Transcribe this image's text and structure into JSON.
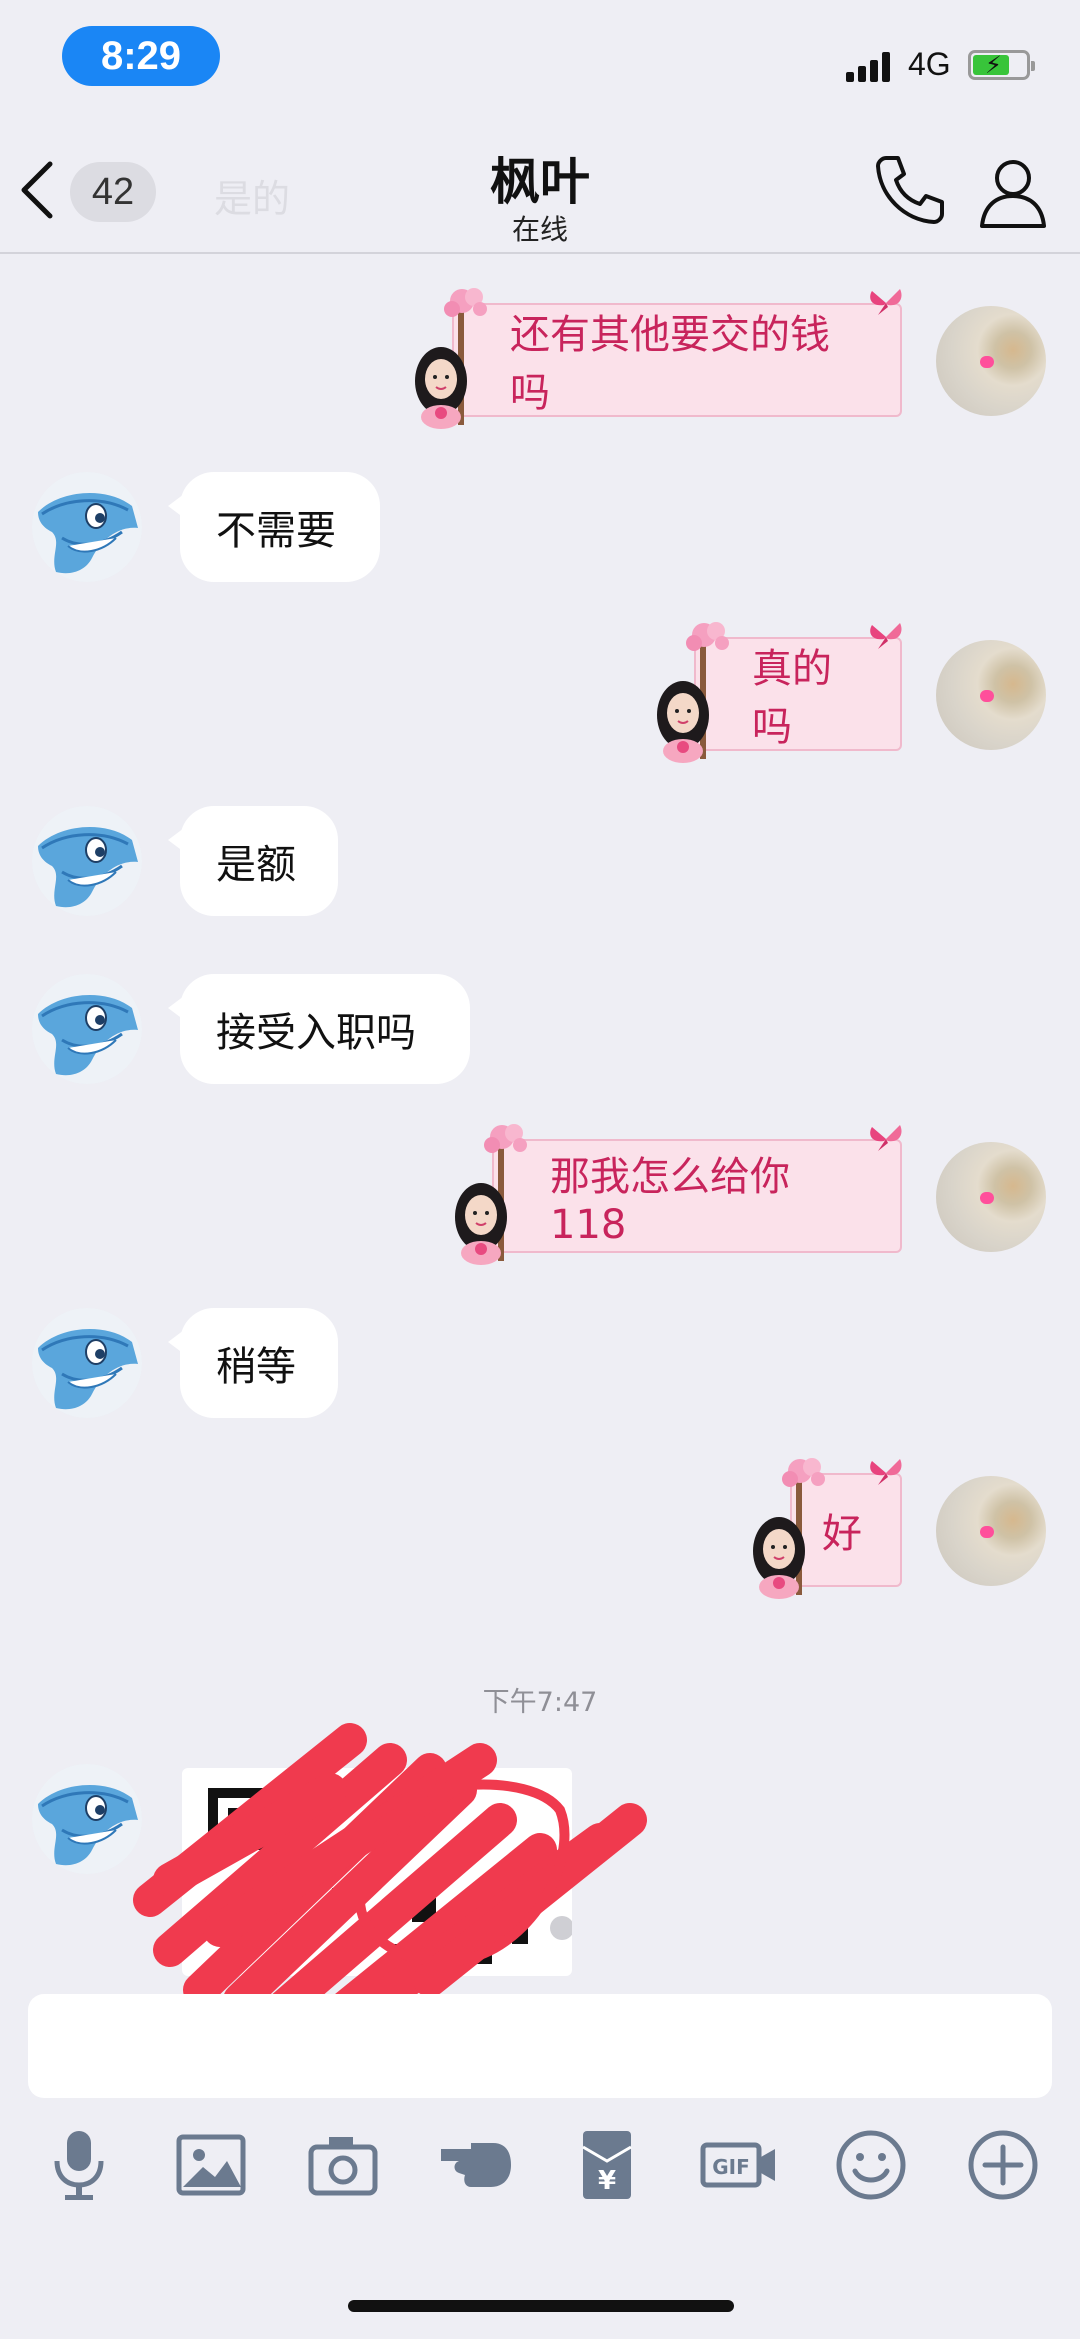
{
  "status": {
    "time": "8:29",
    "network": "4G"
  },
  "header": {
    "unread_count": "42",
    "ghost_text": "是的",
    "title": "枫叶",
    "subtitle": "在线"
  },
  "messages": [
    {
      "side": "right",
      "text": "还有其他要交的钱吗"
    },
    {
      "side": "left",
      "text": "不需要"
    },
    {
      "side": "right",
      "text": "真的吗"
    },
    {
      "side": "left",
      "text": "是额"
    },
    {
      "side": "left",
      "text": "接受入职吗"
    },
    {
      "side": "right",
      "text": "那我怎么给你118"
    },
    {
      "side": "left",
      "text": "稍等"
    },
    {
      "side": "right",
      "text": "好"
    }
  ],
  "timestamp": "下午7:47",
  "colors": {
    "accent_blue": "#1a86f5",
    "bubble_pink": "#fbe1ea",
    "bubble_text": "#c8245c",
    "scribble_red": "#f03a4e"
  },
  "toolbar": {
    "icons": [
      "microphone-icon",
      "image-icon",
      "camera-icon",
      "poke-hand-icon",
      "red-envelope-icon",
      "gif-icon",
      "emoji-icon",
      "plus-icon"
    ]
  }
}
